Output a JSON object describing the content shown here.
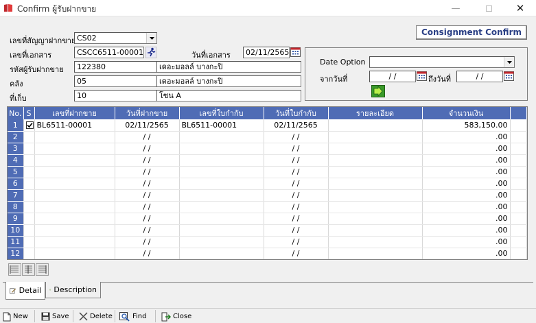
{
  "window": {
    "title": "Confirm ผู้รับฝากขาย"
  },
  "header": {
    "contract_label": "เลขที่สัญญาฝากขาย",
    "contract_value": "CS02",
    "doc_no_label": "เลขที่เอกสาร",
    "doc_no_value": "CSCC6511-00001",
    "doc_date_label": "วันที่เอกสาร",
    "doc_date_value": "02/11/2565",
    "receiver_code_label": "รหัสผู้รับฝากขาย",
    "receiver_code_value": "122380",
    "receiver_name_value": "เดอะมอลล์ บางกะปิ",
    "warehouse_label": "คลัง",
    "warehouse_code_value": "05",
    "warehouse_name_value": "เดอะมอลล์ บางกะปิ",
    "location_label": "ที่เก็บ",
    "location_code_value": "10",
    "location_name_value": "โซน A",
    "confirm_button_label": "Consignment Confirm"
  },
  "date_panel": {
    "option_label": "Date Option",
    "option_value": "",
    "from_label": "จากวันที่",
    "from_value": "/ /",
    "to_label": "ถึงวันที่",
    "to_value": "/ /"
  },
  "grid": {
    "columns": [
      "No.",
      "S",
      "เลขที่ฝากขาย",
      "วันที่ฝากขาย",
      "เลขที่ใบกำกับ",
      "วันที่ใบกำกับ",
      "รายละเอียด",
      "จำนวนเงิน"
    ],
    "rows": [
      {
        "no": "1",
        "checked": true,
        "consign_no": "BL6511-00001",
        "consign_date": "02/11/2565",
        "invoice_no": "BL6511-00001",
        "invoice_date": "02/11/2565",
        "detail": "",
        "amount": "583,150.00"
      },
      {
        "no": "2",
        "checked": false,
        "consign_no": "",
        "consign_date": "/ /",
        "invoice_no": "",
        "invoice_date": "/ /",
        "detail": "",
        "amount": ".00"
      },
      {
        "no": "3",
        "checked": false,
        "consign_no": "",
        "consign_date": "/ /",
        "invoice_no": "",
        "invoice_date": "/ /",
        "detail": "",
        "amount": ".00"
      },
      {
        "no": "4",
        "checked": false,
        "consign_no": "",
        "consign_date": "/ /",
        "invoice_no": "",
        "invoice_date": "/ /",
        "detail": "",
        "amount": ".00"
      },
      {
        "no": "5",
        "checked": false,
        "consign_no": "",
        "consign_date": "/ /",
        "invoice_no": "",
        "invoice_date": "/ /",
        "detail": "",
        "amount": ".00"
      },
      {
        "no": "6",
        "checked": false,
        "consign_no": "",
        "consign_date": "/ /",
        "invoice_no": "",
        "invoice_date": "/ /",
        "detail": "",
        "amount": ".00"
      },
      {
        "no": "7",
        "checked": false,
        "consign_no": "",
        "consign_date": "/ /",
        "invoice_no": "",
        "invoice_date": "/ /",
        "detail": "",
        "amount": ".00"
      },
      {
        "no": "8",
        "checked": false,
        "consign_no": "",
        "consign_date": "/ /",
        "invoice_no": "",
        "invoice_date": "/ /",
        "detail": "",
        "amount": ".00"
      },
      {
        "no": "9",
        "checked": false,
        "consign_no": "",
        "consign_date": "/ /",
        "invoice_no": "",
        "invoice_date": "/ /",
        "detail": "",
        "amount": ".00"
      },
      {
        "no": "10",
        "checked": false,
        "consign_no": "",
        "consign_date": "/ /",
        "invoice_no": "",
        "invoice_date": "/ /",
        "detail": "",
        "amount": ".00"
      },
      {
        "no": "11",
        "checked": false,
        "consign_no": "",
        "consign_date": "/ /",
        "invoice_no": "",
        "invoice_date": "/ /",
        "detail": "",
        "amount": ".00"
      },
      {
        "no": "12",
        "checked": false,
        "consign_no": "",
        "consign_date": "/ /",
        "invoice_no": "",
        "invoice_date": "/ /",
        "detail": "",
        "amount": ".00"
      }
    ]
  },
  "tabs": [
    {
      "label": "Detail",
      "icon": "edit-doc-icon",
      "active": true
    },
    {
      "label": "Description",
      "icon": "pencil-note-icon",
      "active": false
    }
  ],
  "toolbar": {
    "new_label": "New",
    "save_label": "Save",
    "delete_label": "Delete",
    "find_label": "Find",
    "close_label": "Close"
  },
  "colors": {
    "grid_header": "#4f6cb5",
    "confirm_text": "#2a3f85"
  }
}
